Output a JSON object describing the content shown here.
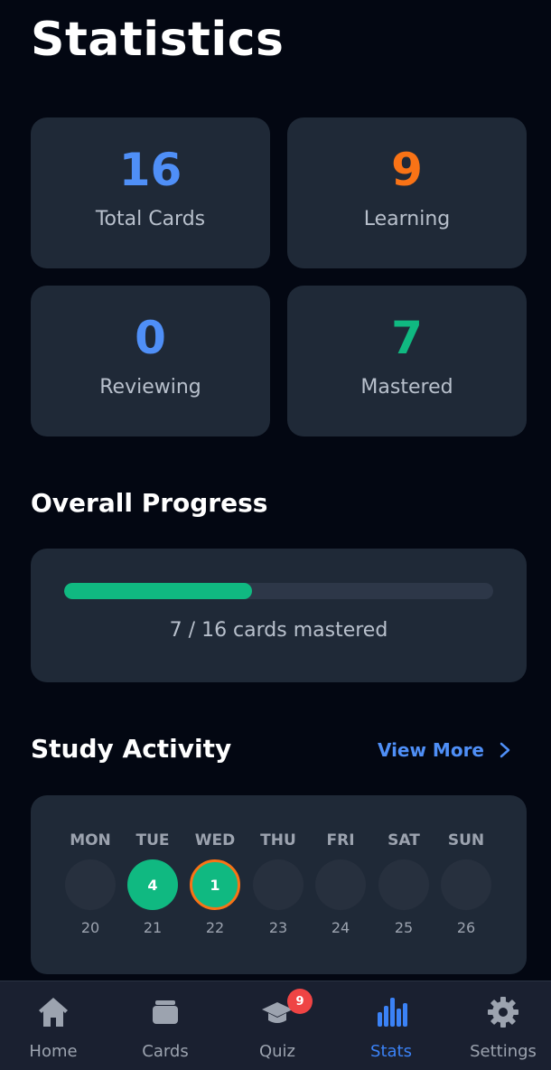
{
  "header": {
    "title": "Statistics"
  },
  "stats": {
    "total": {
      "value": "16",
      "label": "Total Cards",
      "color": "#4f8ff7"
    },
    "learning": {
      "value": "9",
      "label": "Learning",
      "color": "#f97316"
    },
    "reviewing": {
      "value": "0",
      "label": "Reviewing",
      "color": "#4f8ff7"
    },
    "mastered": {
      "value": "7",
      "label": "Mastered",
      "color": "#10b981"
    }
  },
  "progress": {
    "title": "Overall Progress",
    "mastered": 7,
    "total": 16,
    "text": "7 / 16 cards mastered",
    "fraction": 0.4375
  },
  "activity": {
    "title": "Study Activity",
    "view_more": "View More",
    "days": [
      {
        "name": "MON",
        "date": "20",
        "count": ""
      },
      {
        "name": "TUE",
        "date": "21",
        "count": "4"
      },
      {
        "name": "WED",
        "date": "22",
        "count": "1"
      },
      {
        "name": "THU",
        "date": "23",
        "count": ""
      },
      {
        "name": "FRI",
        "date": "24",
        "count": ""
      },
      {
        "name": "SAT",
        "date": "25",
        "count": ""
      },
      {
        "name": "SUN",
        "date": "26",
        "count": ""
      }
    ]
  },
  "tabs": [
    {
      "label": "Home",
      "icon": "home-icon"
    },
    {
      "label": "Cards",
      "icon": "cards-icon"
    },
    {
      "label": "Quiz",
      "icon": "graduation-cap-icon",
      "badge": "9"
    },
    {
      "label": "Stats",
      "icon": "bar-chart-icon",
      "selected": true
    },
    {
      "label": "Settings",
      "icon": "gear-icon"
    }
  ],
  "colors": {
    "background": "#030712",
    "card": "#1f2937",
    "accent_blue": "#3b82f6",
    "accent_green": "#10b981",
    "accent_orange": "#f97316",
    "badge_red": "#ef4444"
  }
}
